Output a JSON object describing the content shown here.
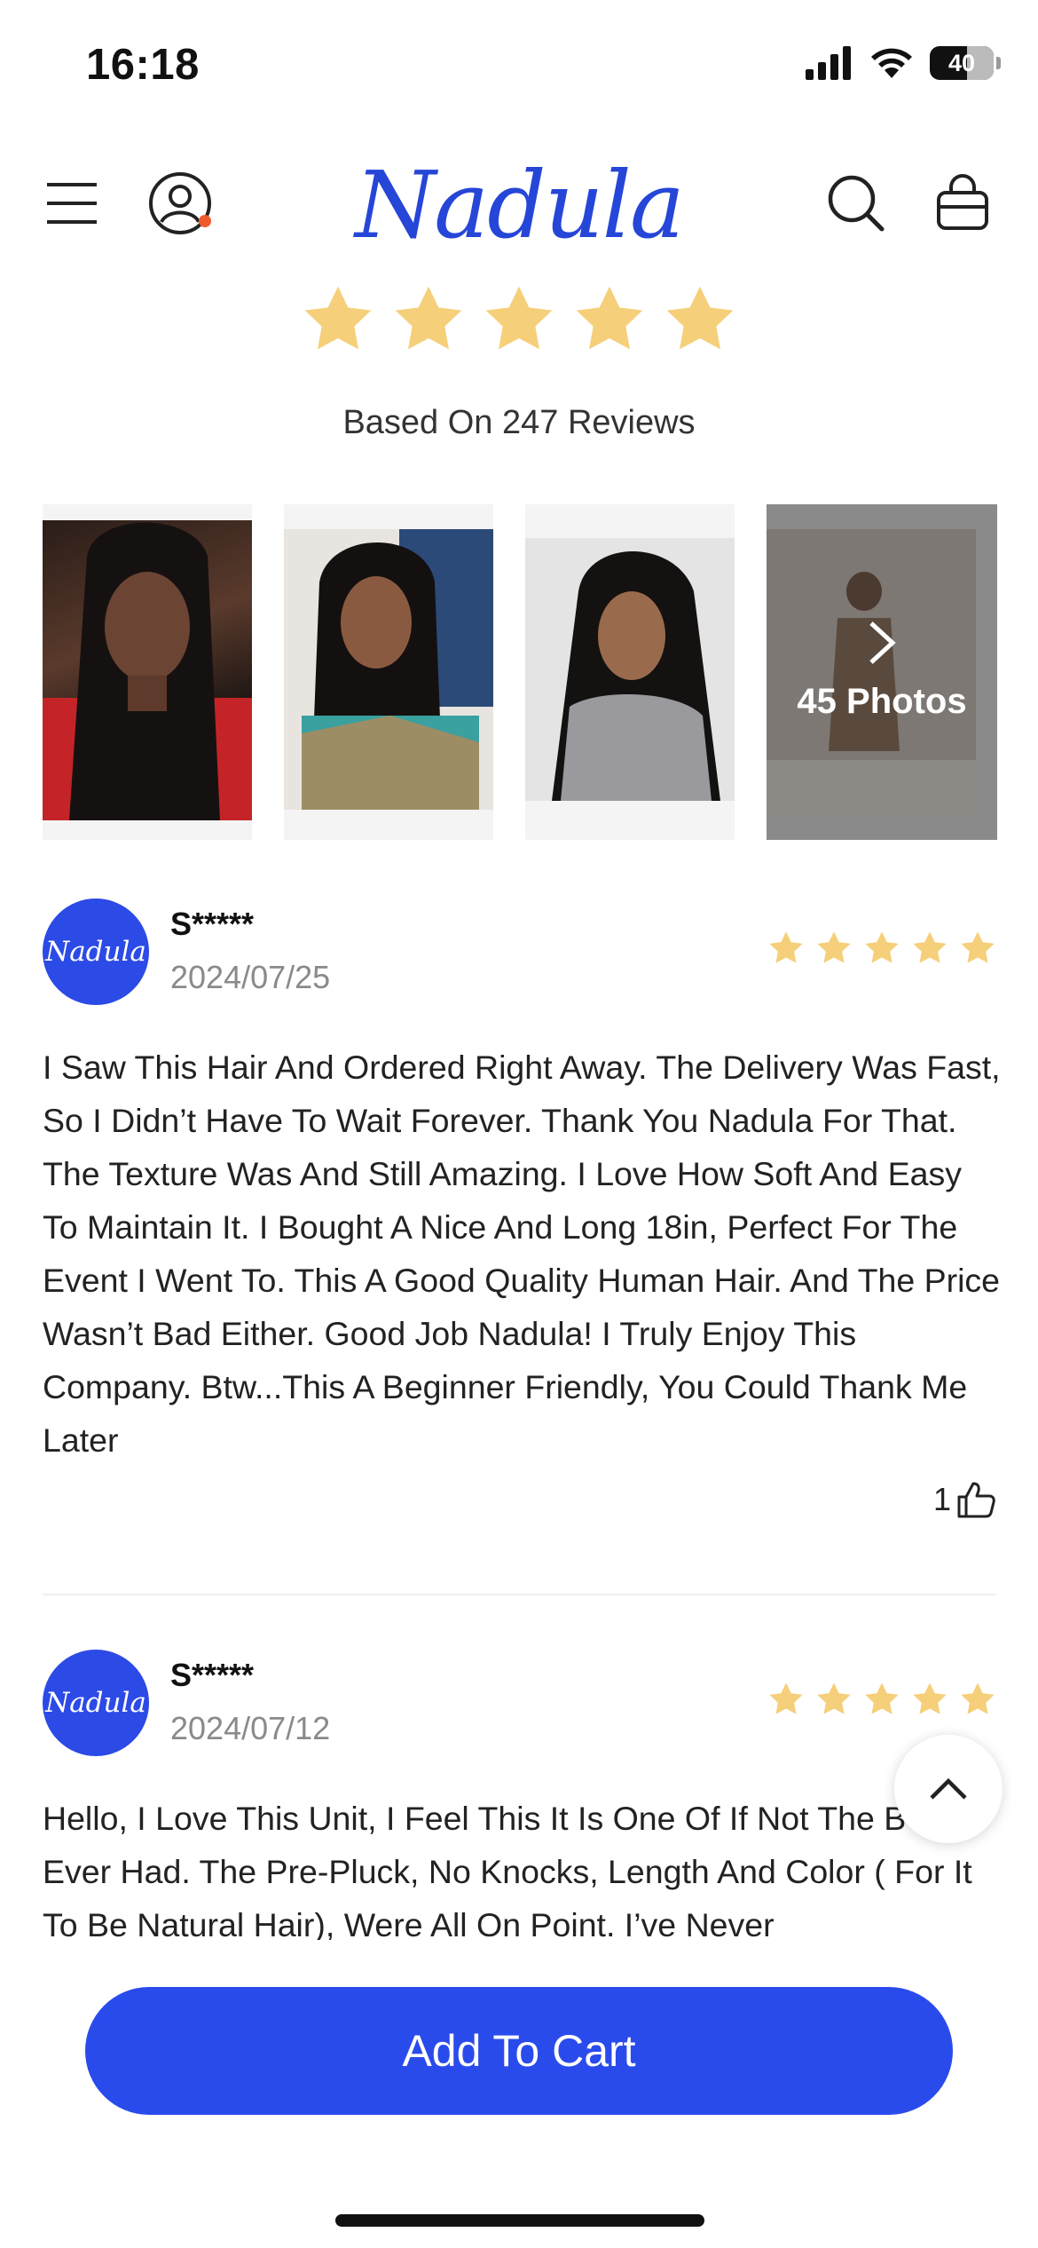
{
  "status_bar": {
    "time": "16:18",
    "battery": "40"
  },
  "header": {
    "logo": "Nadula"
  },
  "summary": {
    "rating_stars": 5,
    "text": "Based On 247 Reviews",
    "star_color": "#f6cf7a"
  },
  "photos": {
    "more_label": "45 Photos"
  },
  "reviews": [
    {
      "avatar_text": "Nadula",
      "name": "S*****",
      "date": "2024/07/25",
      "stars": 5,
      "body": "I Saw This Hair And Ordered Right Away. The Delivery Was Fast, So I Didn’t Have To Wait Forever. Thank You Nadula For That. The Texture Was And Still Amazing. I Love How Soft And Easy To Maintain It. I Bought A Nice And Long 18in, Perfect For The Event I Went To. This A Good Quality Human Hair. And The Price Wasn’t Bad Either. Good Job Nadula! I Truly Enjoy This Company. Btw...This A Beginner Friendly, You Could Thank Me Later",
      "likes": "1"
    },
    {
      "avatar_text": "Nadula",
      "name": "S*****",
      "date": "2024/07/12",
      "stars": 5,
      "body": "Hello, I Love This Unit, I Feel This It Is One Of If Not The B I’ve Ever Had. The Pre-Pluck, No Knocks, Length And Color ( For It To Be Natural Hair), Were All On Point. I’ve Never"
    }
  ],
  "cart": {
    "label": "Add To Cart",
    "color": "#2a4bec"
  }
}
